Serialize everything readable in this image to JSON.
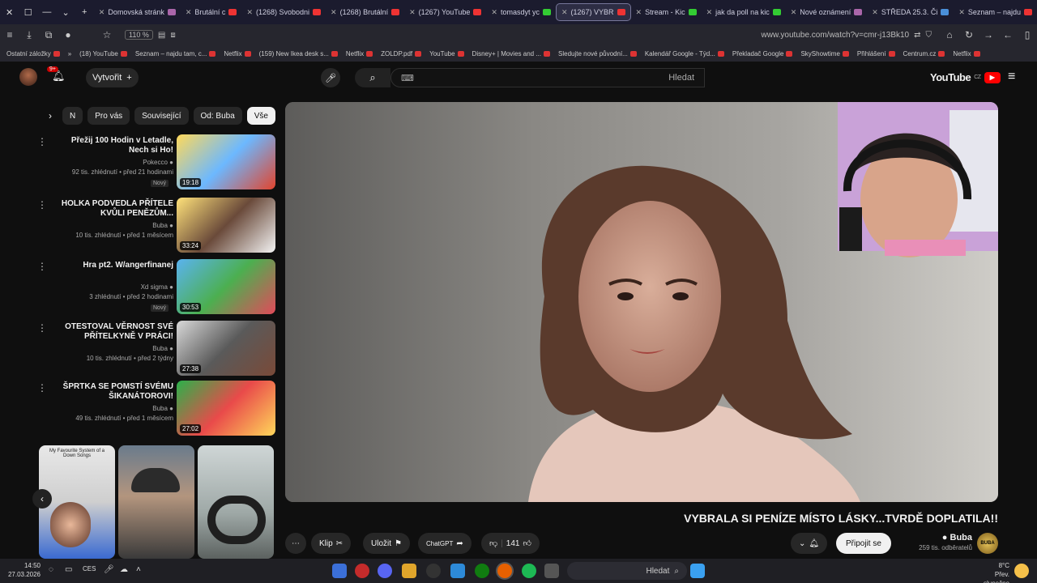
{
  "tabs": [
    {
      "label": "Domovská stránk",
      "icon": "youtube-icon",
      "active": false
    },
    {
      "label": "Brutální c",
      "icon": "youtube-icon",
      "active": false
    },
    {
      "label": "(1268) Svobodni",
      "icon": "youtube-icon",
      "active": false
    },
    {
      "label": "(1268) Brutální",
      "icon": "youtube-icon",
      "active": false
    },
    {
      "label": "(1267) YouTube",
      "icon": "youtube-icon",
      "active": false
    },
    {
      "label": "tomasdyt yc",
      "icon": "kick-icon",
      "active": false
    },
    {
      "label": "(1267) VYBR",
      "icon": "youtube-icon",
      "active": true
    },
    {
      "label": "Stream - Kic",
      "icon": "kick-icon",
      "active": false
    },
    {
      "label": "jak da poll na kic",
      "icon": "chrome-icon",
      "active": false
    },
    {
      "label": "Nové oznámení",
      "icon": "gmail-icon",
      "active": false
    },
    {
      "label": "STŘEDA 25.3. Či",
      "icon": "doc-icon",
      "active": false
    },
    {
      "label": "Seznam – najdu",
      "icon": "seznam-icon",
      "active": false
    }
  ],
  "address": {
    "url": "www.youtube.com/watch?v=cmr-j13Bk10",
    "zoom": "110 %"
  },
  "bookmarks": [
    "Netflix",
    "Centrum.cz",
    "Přihlášení",
    "SkyShowtime",
    "Překladač Google",
    "Kalendář Google - Týd...",
    "Sledujte nové původní...",
    "Disney+ | Movies and ...",
    "YouTube",
    "ZOLDP.pdf",
    "Netflix",
    "(159) New Ikea desk s...",
    "Netflix",
    "Seznam – najdu tam, c...",
    "(18) YouTube",
    "Ostatní záložky"
  ],
  "header": {
    "logo": "YouTube",
    "logo_region": "CZ",
    "search_placeholder": "Hledat",
    "create_label": "Vytvořit",
    "notif_count": "9+"
  },
  "chips": [
    "Vše",
    "Od: Buba",
    "Související",
    "Pro vás",
    "N"
  ],
  "recommendations": [
    {
      "title": "Přežij 100 Hodin v Letadle, Nech si Ho!",
      "channel": "Pokecco",
      "meta": "92 tis. zhlédnutí • před 21 hodinami",
      "badge": "Nový",
      "duration": "19:18"
    },
    {
      "title": "HOLKA PODVEDLA PŘÍTELE KVŮLI PENĚZŮM...",
      "channel": "Buba",
      "meta": "10 tis. zhlédnutí • před 1 měsícem",
      "badge": "",
      "duration": "33:24"
    },
    {
      "title": "Hra pt2. W/angerfinanej",
      "channel": "Xd sigma",
      "meta": "3 zhlédnutí • před 2 hodinami",
      "badge": "Nový",
      "duration": "30:53"
    },
    {
      "title": "OTESTOVAL VĚRNOST SVÉ PŘÍTELKYNĚ V PRÁCI!",
      "channel": "Buba",
      "meta": "10 tis. zhlédnutí • před 2 týdny",
      "badge": "",
      "duration": "27:38"
    },
    {
      "title": "ŠPRTKA SE POMSTÍ SVÉMU ŠIKANÁTOROVI!",
      "channel": "Buba",
      "meta": "49 tis. zhlédnutí • před 1 měsícem",
      "badge": "",
      "duration": "27:02"
    }
  ],
  "shorts_text": "My Favourite System of a Down Songs",
  "video": {
    "title": "VYBRALA SI PENÍZE MÍSTO LÁSKY...TVRDĚ DOPLATILA!!",
    "likes": "141",
    "channel": "Buba",
    "subscribers": "259 tis. odběratelů",
    "join_label": "Připojit se",
    "save_label": "Uložit",
    "clip_label": "Klip",
    "share_label": "ChatGPT",
    "channel_logo_text": "BUBA"
  },
  "taskbar": {
    "search_placeholder": "Hledat",
    "time": "14:50",
    "date": "27.03.2026",
    "lang": "CES",
    "weather_temp": "8°C",
    "weather_desc": "Přev. slunečno"
  }
}
